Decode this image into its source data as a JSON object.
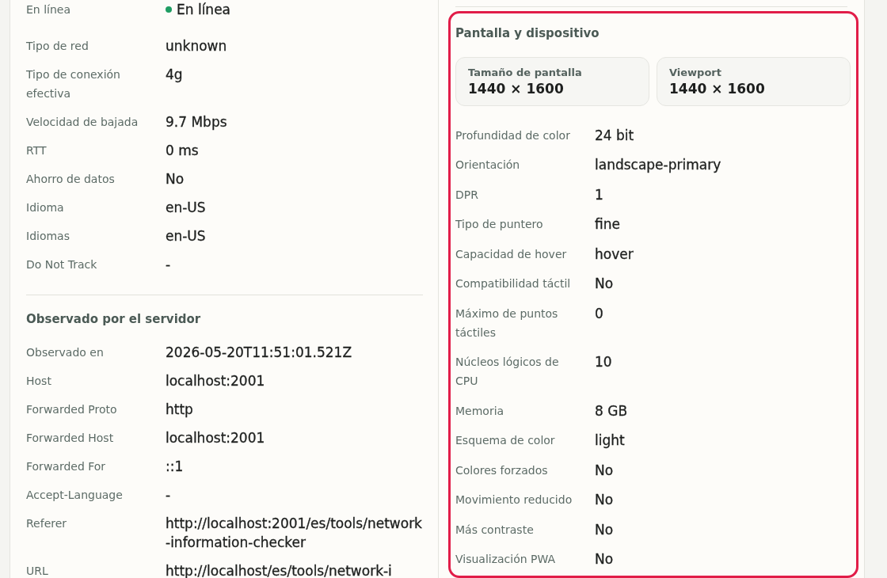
{
  "left_panel": {
    "sections": [
      {
        "rows": [
          {
            "kind": "status",
            "label": "En línea",
            "value": "En línea",
            "color": "#1f9d63"
          },
          {
            "kind": "text",
            "label": "Tipo de red",
            "value": "unknown"
          },
          {
            "kind": "text",
            "label": "Tipo de conexión efectiva",
            "value": "4g"
          },
          {
            "kind": "text",
            "label": "Velocidad de bajada",
            "value": "9.7 Mbps"
          },
          {
            "kind": "text",
            "label": "RTT",
            "value": "0 ms"
          },
          {
            "kind": "text",
            "label": "Ahorro de datos",
            "value": "No"
          },
          {
            "kind": "text",
            "label": "Idioma",
            "value": "en-US"
          },
          {
            "kind": "text",
            "label": "Idiomas",
            "value": "en-US"
          },
          {
            "kind": "text",
            "label": "Do Not Track",
            "value": "-"
          }
        ]
      },
      {
        "title": "Observado por el servidor",
        "rows": [
          {
            "kind": "text",
            "label": "Observado en",
            "value": "2026-05-20T11:51:01.521Z"
          },
          {
            "kind": "text",
            "label": "Host",
            "value": "localhost:2001"
          },
          {
            "kind": "text",
            "label": "Forwarded Proto",
            "value": "http"
          },
          {
            "kind": "text",
            "label": "Forwarded Host",
            "value": "localhost:2001"
          },
          {
            "kind": "text",
            "label": "Forwarded For",
            "value": "::1"
          },
          {
            "kind": "text",
            "label": "Accept-Language",
            "value": "-"
          },
          {
            "kind": "text",
            "label": "Referer",
            "value": "http://localhost:2001/es/tools/network-information-checker"
          },
          {
            "kind": "text",
            "label": "URL",
            "value": "http://localhost/es/tools/network-i"
          }
        ]
      }
    ]
  },
  "right_panel": {
    "sections": [
      {
        "title": "Pantalla y dispositivo",
        "highlighted": true,
        "cards": [
          {
            "label": "Tamaño de pantalla",
            "value": "1440 × 1600"
          },
          {
            "label": "Viewport",
            "value": "1440 × 1600"
          }
        ],
        "rows": [
          {
            "kind": "text",
            "label": "Profundidad de color",
            "value": "24 bit"
          },
          {
            "kind": "text",
            "label": "Orientación",
            "value": "landscape-primary"
          },
          {
            "kind": "text",
            "label": "DPR",
            "value": "1"
          },
          {
            "kind": "text",
            "label": "Tipo de puntero",
            "value": "fine"
          },
          {
            "kind": "text",
            "label": "Capacidad de hover",
            "value": "hover"
          },
          {
            "kind": "text",
            "label": "Compatibilidad táctil",
            "value": "No"
          },
          {
            "kind": "text",
            "label": "Máximo de puntos táctiles",
            "value": "0"
          },
          {
            "kind": "text",
            "label": "Núcleos lógicos de CPU",
            "value": "10"
          },
          {
            "kind": "text",
            "label": "Memoria",
            "value": "8 GB"
          },
          {
            "kind": "text",
            "label": "Esquema de color",
            "value": "light"
          },
          {
            "kind": "text",
            "label": "Colores forzados",
            "value": "No"
          },
          {
            "kind": "text",
            "label": "Movimiento reducido",
            "value": "No"
          },
          {
            "kind": "text",
            "label": "Más contraste",
            "value": "No"
          },
          {
            "kind": "text",
            "label": "Visualización PWA",
            "value": "No"
          }
        ]
      }
    ]
  }
}
